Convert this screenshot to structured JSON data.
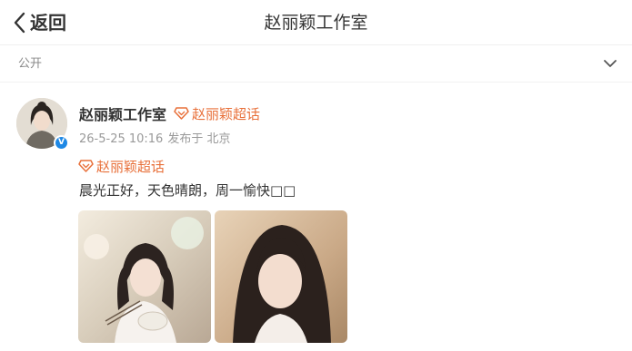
{
  "header": {
    "back_label": "返回",
    "title": "赵丽颖工作室"
  },
  "visibility": {
    "label": "公开"
  },
  "post": {
    "author": "赵丽颖工作室",
    "supertopic": "赵丽颖超话",
    "time": "26-5-25 10:16",
    "location": "发布于 北京",
    "content_tag": "赵丽颖超话",
    "text": "晨光正好，天色晴朗，周一愉快□□",
    "verified_mark": "V"
  },
  "colors": {
    "accent_orange": "#e8703a",
    "verified_blue": "#1e88e5"
  },
  "icons": [
    "back-chevron-icon",
    "chevron-down-icon",
    "supertopic-diamond-icon",
    "verified-icon"
  ]
}
